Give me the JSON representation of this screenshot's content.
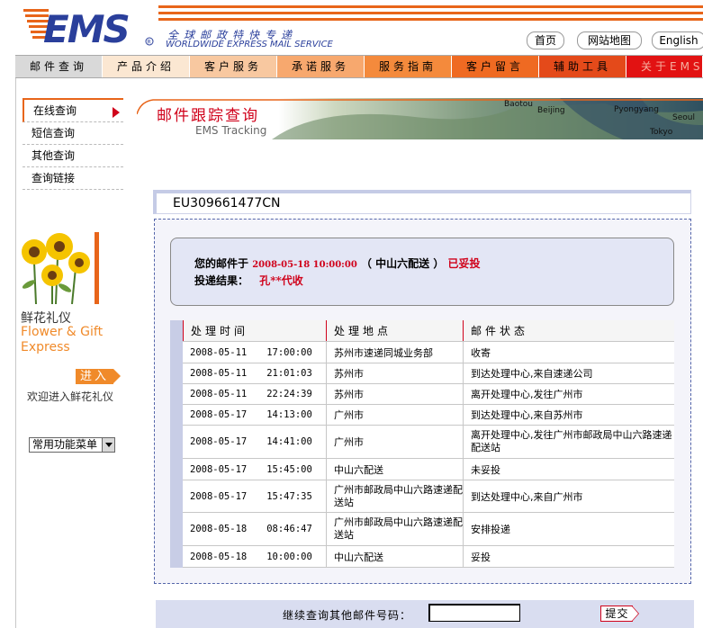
{
  "header": {
    "logo_text": "EMS",
    "slogan_cn": "全球邮政特快专递",
    "slogan_en": "WORLDWIDE EXPRESS MAIL SERVICE",
    "links": [
      "首页",
      "网站地图",
      "English"
    ]
  },
  "nav": {
    "items": [
      {
        "label": "邮件查询",
        "bg": "#d9d9d9",
        "color": "#000000"
      },
      {
        "label": "产品介绍",
        "bg": "#fbe7d2",
        "color": "#000000"
      },
      {
        "label": "客户服务",
        "bg": "#f8c8a0",
        "color": "#000000"
      },
      {
        "label": "承诺服务",
        "bg": "#f7a86e",
        "color": "#000000"
      },
      {
        "label": "服务指南",
        "bg": "#f48a3c",
        "color": "#000000"
      },
      {
        "label": "客户留言",
        "bg": "#ef6a22",
        "color": "#000000"
      },
      {
        "label": "辅助工具",
        "bg": "#e44a1a",
        "color": "#000000"
      },
      {
        "label": "关于EMS",
        "bg": "#e21212",
        "color": "#f6b0a0"
      }
    ]
  },
  "side_menu": {
    "items": [
      "在线查询",
      "短信查询",
      "其他查询",
      "查询链接"
    ]
  },
  "flower": {
    "title_cn": "鲜花礼仪",
    "title_en_1": "Flower & Gift",
    "title_en_2": "Express",
    "enter_label": "进入",
    "welcome": "欢迎进入鲜花礼仪"
  },
  "func_menu": {
    "selected": "常用功能菜单"
  },
  "banner": {
    "title_cn": "邮件跟踪查询",
    "title_en": "EMS Tracking",
    "map_labels": [
      "Beijing",
      "Baotou",
      "Pyongyang",
      "Seoul",
      "Tokyo"
    ]
  },
  "tracking": {
    "number": "EU309661477CN",
    "summary_prefix": "您的邮件于",
    "summary_datetime": "2008-05-18 10:00:00",
    "summary_place": "（ 中山六配送 ）",
    "summary_status": "已妥投",
    "result_label": "投递结果：",
    "result_value": "孔**代收",
    "columns": [
      "处理时间",
      "处理地点",
      "邮件状态"
    ],
    "rows": [
      {
        "date": "2008-05-11",
        "time": "17:00:00",
        "place": "苏州市速递同城业务部",
        "status": "收寄"
      },
      {
        "date": "2008-05-11",
        "time": "21:01:03",
        "place": "苏州市",
        "status": "到达处理中心,来自速递公司"
      },
      {
        "date": "2008-05-11",
        "time": "22:24:39",
        "place": "苏州市",
        "status": "离开处理中心,发往广州市"
      },
      {
        "date": "2008-05-17",
        "time": "14:13:00",
        "place": "广州市",
        "status": "到达处理中心,来自苏州市"
      },
      {
        "date": "2008-05-17",
        "time": "14:41:00",
        "place": "广州市",
        "status": "离开处理中心,发往广州市邮政局中山六路速递配送站"
      },
      {
        "date": "2008-05-17",
        "time": "15:45:00",
        "place": "中山六配送",
        "status": "未妥投"
      },
      {
        "date": "2008-05-17",
        "time": "15:47:35",
        "place": "广州市邮政局中山六路速递配送站",
        "status": "到达处理中心,来自广州市"
      },
      {
        "date": "2008-05-18",
        "time": "08:46:47",
        "place": "广州市邮政局中山六路速递配送站",
        "status": "安排投递"
      },
      {
        "date": "2008-05-18",
        "time": "10:00:00",
        "place": "中山六配送",
        "status": "妥投"
      }
    ]
  },
  "query": {
    "label": "继续查询其他邮件号码：",
    "input_value": "",
    "submit_label": "提交"
  }
}
